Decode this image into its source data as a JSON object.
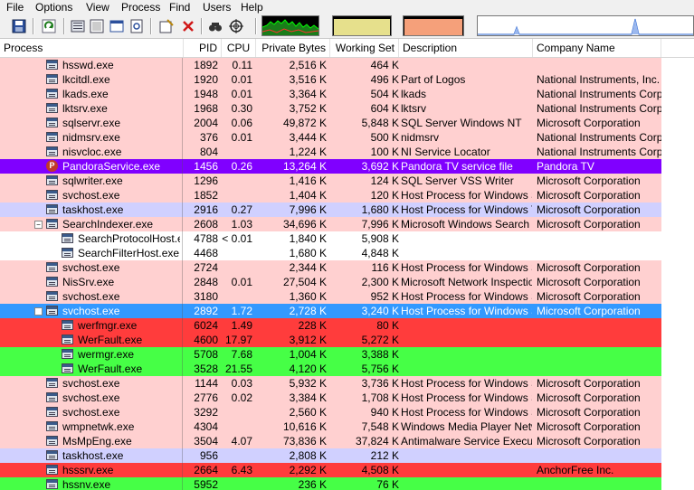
{
  "menu": [
    "File",
    "Options",
    "View",
    "Process",
    "Find",
    "Users",
    "Help"
  ],
  "toolbar_icons": [
    "save-icon",
    "refresh-icon",
    "system-info-icon",
    "window-icon",
    "properties-icon",
    "show-handles-icon",
    "kill-process-icon",
    "find-icon",
    "target-icon"
  ],
  "columns": {
    "process": "Process",
    "pid": "PID",
    "cpu": "CPU",
    "private": "Private Bytes",
    "working": "Working Set",
    "desc": "Description",
    "company": "Company Name"
  },
  "colors": {
    "service": "#ffd0d0",
    "selected": "#3399ff",
    "own": "#d0d0ff",
    "new": "#46ff46",
    "killed": "#ff3c3c",
    "packed": "#8000ff",
    "normal": "#ffffff"
  },
  "rows": [
    {
      "name": "hsswd.exe",
      "pid": "1892",
      "cpu": "0.11",
      "private": "2,516 K",
      "working": "464 K",
      "desc": "",
      "company": "",
      "bg": "service",
      "level": 3
    },
    {
      "name": "lkcitdl.exe",
      "pid": "1920",
      "cpu": "0.01",
      "private": "3,516 K",
      "working": "496 K",
      "desc": "Part of Logos",
      "company": "National Instruments, Inc.",
      "bg": "service",
      "level": 3
    },
    {
      "name": "lkads.exe",
      "pid": "1948",
      "cpu": "0.01",
      "private": "3,364 K",
      "working": "504 K",
      "desc": "lkads",
      "company": "National Instruments Corpo...",
      "bg": "service",
      "level": 3
    },
    {
      "name": "lktsrv.exe",
      "pid": "1968",
      "cpu": "0.30",
      "private": "3,752 K",
      "working": "604 K",
      "desc": "lktsrv",
      "company": "National Instruments Corpo...",
      "bg": "service",
      "level": 3
    },
    {
      "name": "sqlservr.exe",
      "pid": "2004",
      "cpu": "0.06",
      "private": "49,872 K",
      "working": "5,848 K",
      "desc": "SQL Server Windows NT",
      "company": "Microsoft Corporation",
      "bg": "service",
      "level": 3
    },
    {
      "name": "nidmsrv.exe",
      "pid": "376",
      "cpu": "0.01",
      "private": "3,444 K",
      "working": "500 K",
      "desc": "nidmsrv",
      "company": "National Instruments Corpo...",
      "bg": "service",
      "level": 3
    },
    {
      "name": "nisvcloc.exe",
      "pid": "804",
      "cpu": "",
      "private": "1,224 K",
      "working": "100 K",
      "desc": "NI Service Locator",
      "company": "National Instruments Corpo...",
      "bg": "service",
      "level": 3
    },
    {
      "name": "PandoraService.exe",
      "pid": "1456",
      "cpu": "0.26",
      "private": "13,264 K",
      "working": "3,692 K",
      "desc": "Pandora TV service file",
      "company": "Pandora TV",
      "bg": "packed",
      "level": 3,
      "icon": "pandora"
    },
    {
      "name": "sqlwriter.exe",
      "pid": "1296",
      "cpu": "",
      "private": "1,416 K",
      "working": "124 K",
      "desc": "SQL Server VSS Writer",
      "company": "Microsoft Corporation",
      "bg": "service",
      "level": 3
    },
    {
      "name": "svchost.exe",
      "pid": "1852",
      "cpu": "",
      "private": "1,404 K",
      "working": "120 K",
      "desc": "Host Process for Windows S...",
      "company": "Microsoft Corporation",
      "bg": "service",
      "level": 3
    },
    {
      "name": "taskhost.exe",
      "pid": "2916",
      "cpu": "0.27",
      "private": "7,996 K",
      "working": "1,680 K",
      "desc": "Host Process for Windows T...",
      "company": "Microsoft Corporation",
      "bg": "own",
      "level": 3
    },
    {
      "name": "SearchIndexer.exe",
      "pid": "2608",
      "cpu": "1.03",
      "private": "34,696 K",
      "working": "7,996 K",
      "desc": "Microsoft Windows Search I...",
      "company": "Microsoft Corporation",
      "bg": "service",
      "level": 3,
      "toggle": "−"
    },
    {
      "name": "SearchProtocolHost.e...",
      "pid": "4788",
      "cpu": "< 0.01",
      "private": "1,840 K",
      "working": "5,908 K",
      "desc": "",
      "company": "",
      "bg": "normal",
      "level": 4
    },
    {
      "name": "SearchFilterHost.exe",
      "pid": "4468",
      "cpu": "",
      "private": "1,680 K",
      "working": "4,848 K",
      "desc": "",
      "company": "",
      "bg": "normal",
      "level": 4
    },
    {
      "name": "svchost.exe",
      "pid": "2724",
      "cpu": "",
      "private": "2,344 K",
      "working": "116 K",
      "desc": "Host Process for Windows S...",
      "company": "Microsoft Corporation",
      "bg": "service",
      "level": 3
    },
    {
      "name": "NisSrv.exe",
      "pid": "2848",
      "cpu": "0.01",
      "private": "27,504 K",
      "working": "2,300 K",
      "desc": "Microsoft Network Inspectio...",
      "company": "Microsoft Corporation",
      "bg": "service",
      "level": 3
    },
    {
      "name": "svchost.exe",
      "pid": "3180",
      "cpu": "",
      "private": "1,360 K",
      "working": "952 K",
      "desc": "Host Process for Windows S...",
      "company": "Microsoft Corporation",
      "bg": "service",
      "level": 3
    },
    {
      "name": "svchost.exe",
      "pid": "2892",
      "cpu": "1.72",
      "private": "2,728 K",
      "working": "3,240 K",
      "desc": "Host Process for Windows S...",
      "company": "Microsoft Corporation",
      "bg": "selected",
      "level": 3,
      "toggle": "−",
      "selected": true
    },
    {
      "name": "werfmgr.exe",
      "pid": "6024",
      "cpu": "1.49",
      "private": "228 K",
      "working": "80 K",
      "desc": "",
      "company": "",
      "bg": "killed",
      "level": 4
    },
    {
      "name": "WerFault.exe",
      "pid": "4600",
      "cpu": "17.97",
      "private": "3,912 K",
      "working": "5,272 K",
      "desc": "",
      "company": "",
      "bg": "killed",
      "level": 4
    },
    {
      "name": "wermgr.exe",
      "pid": "5708",
      "cpu": "7.68",
      "private": "1,004 K",
      "working": "3,388 K",
      "desc": "",
      "company": "",
      "bg": "new",
      "level": 4
    },
    {
      "name": "WerFault.exe",
      "pid": "3528",
      "cpu": "21.55",
      "private": "4,120 K",
      "working": "5,756 K",
      "desc": "",
      "company": "",
      "bg": "new",
      "level": 4
    },
    {
      "name": "svchost.exe",
      "pid": "1144",
      "cpu": "0.03",
      "private": "5,932 K",
      "working": "3,736 K",
      "desc": "Host Process for Windows S...",
      "company": "Microsoft Corporation",
      "bg": "service",
      "level": 3
    },
    {
      "name": "svchost.exe",
      "pid": "2776",
      "cpu": "0.02",
      "private": "3,384 K",
      "working": "1,708 K",
      "desc": "Host Process for Windows S...",
      "company": "Microsoft Corporation",
      "bg": "service",
      "level": 3
    },
    {
      "name": "svchost.exe",
      "pid": "3292",
      "cpu": "",
      "private": "2,560 K",
      "working": "940 K",
      "desc": "Host Process for Windows S...",
      "company": "Microsoft Corporation",
      "bg": "service",
      "level": 3
    },
    {
      "name": "wmpnetwk.exe",
      "pid": "4304",
      "cpu": "",
      "private": "10,616 K",
      "working": "7,548 K",
      "desc": "Windows Media Player Netw...",
      "company": "Microsoft Corporation",
      "bg": "service",
      "level": 3
    },
    {
      "name": "MsMpEng.exe",
      "pid": "3504",
      "cpu": "4.07",
      "private": "73,836 K",
      "working": "37,824 K",
      "desc": "Antimalware Service Execut...",
      "company": "Microsoft Corporation",
      "bg": "service",
      "level": 3
    },
    {
      "name": "taskhost.exe",
      "pid": "956",
      "cpu": "",
      "private": "2,808 K",
      "working": "212 K",
      "desc": "",
      "company": "",
      "bg": "own",
      "level": 3
    },
    {
      "name": "hsssrv.exe",
      "pid": "2664",
      "cpu": "6.43",
      "private": "2,292 K",
      "working": "4,508 K",
      "desc": "",
      "company": "AnchorFree Inc.",
      "bg": "killed",
      "level": 3
    },
    {
      "name": "hssnv.exe",
      "pid": "5952",
      "cpu": "",
      "private": "236 K",
      "working": "76 K",
      "desc": "",
      "company": "",
      "bg": "new",
      "level": 3
    }
  ]
}
